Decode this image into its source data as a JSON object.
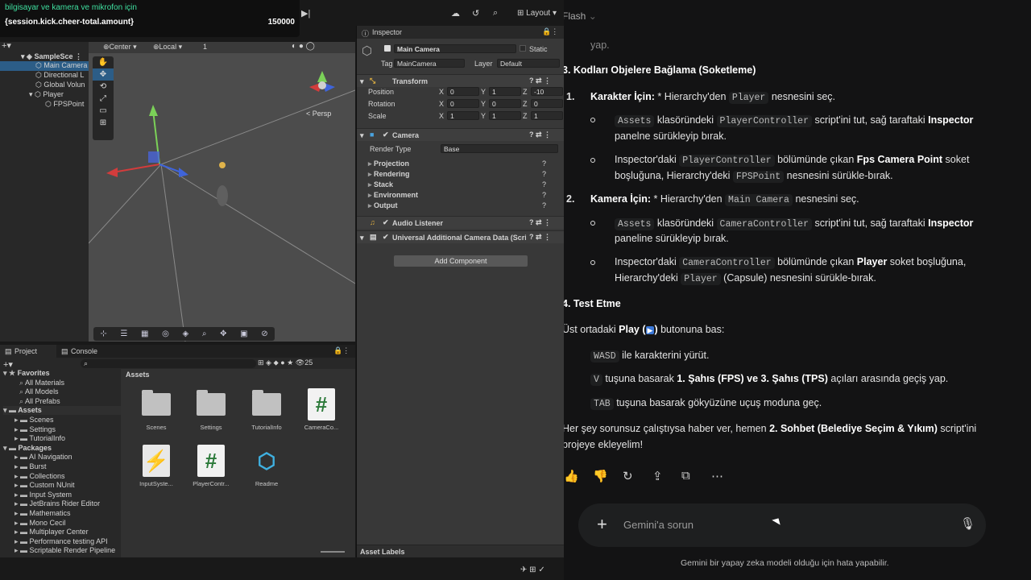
{
  "overlay": {
    "line1": "bilgisayar ve kamera ve mikrofon için",
    "line2_key": "{session.kick.cheer-total.amount}",
    "line2_value": "150000"
  },
  "unity": {
    "layout_label": "Layout",
    "hierarchy": {
      "items": [
        "SampleSce",
        "Main Camera",
        "Directional L",
        "Global Volun",
        "Player",
        "FPSPoint"
      ]
    },
    "scene": {
      "pivot": "Center",
      "space": "Local",
      "grid_value": "1",
      "persp_label": "< Persp"
    },
    "inspector": {
      "tab": "Inspector",
      "object_name": "Main Camera",
      "static_label": "Static",
      "tag_label": "Tag",
      "tag_value": "MainCamera",
      "layer_label": "Layer",
      "layer_value": "Default",
      "transform": {
        "title": "Transform",
        "position_label": "Position",
        "rotation_label": "Rotation",
        "scale_label": "Scale",
        "position": [
          "0",
          "1",
          "-10"
        ],
        "rotation": [
          "0",
          "0",
          "0"
        ],
        "scale": [
          "1",
          "1",
          "1"
        ]
      },
      "camera": {
        "title": "Camera",
        "render_type_label": "Render Type",
        "render_type_value": "Base",
        "sections": [
          "Projection",
          "Rendering",
          "Stack",
          "Environment",
          "Output"
        ]
      },
      "audio_listener": "Audio Listener",
      "urp_data": "Universal Additional Camera Data (Scri",
      "add_component": "Add Component",
      "asset_labels": "Asset Labels"
    },
    "project": {
      "tab_project": "Project",
      "tab_console": "Console",
      "count": "25",
      "assets_header": "Assets",
      "tree": [
        {
          "label": "Favorites",
          "level": 0,
          "bold": true
        },
        {
          "label": "All Materials",
          "level": 2
        },
        {
          "label": "All Models",
          "level": 2
        },
        {
          "label": "All Prefabs",
          "level": 2
        },
        {
          "label": "Assets",
          "level": 0,
          "bold": true
        },
        {
          "label": "Scenes",
          "level": 1
        },
        {
          "label": "Settings",
          "level": 1
        },
        {
          "label": "TutorialInfo",
          "level": 1
        },
        {
          "label": "Packages",
          "level": 0,
          "bold": true
        },
        {
          "label": "AI Navigation",
          "level": 1
        },
        {
          "label": "Burst",
          "level": 1
        },
        {
          "label": "Collections",
          "level": 1
        },
        {
          "label": "Custom NUnit",
          "level": 1
        },
        {
          "label": "Input System",
          "level": 1
        },
        {
          "label": "JetBrains Rider Editor",
          "level": 1
        },
        {
          "label": "Mathematics",
          "level": 1
        },
        {
          "label": "Mono Cecil",
          "level": 1
        },
        {
          "label": "Multiplayer Center",
          "level": 1
        },
        {
          "label": "Performance testing API",
          "level": 1
        },
        {
          "label": "Scriptable Render Pipeline",
          "level": 1
        }
      ],
      "assets": [
        {
          "name": "Scenes",
          "kind": "folder"
        },
        {
          "name": "Settings",
          "kind": "folder"
        },
        {
          "name": "TutorialInfo",
          "kind": "folder"
        },
        {
          "name": "CameraCo...",
          "kind": "script"
        },
        {
          "name": "InputSyste...",
          "kind": "inputsystem"
        },
        {
          "name": "PlayerContr...",
          "kind": "script"
        },
        {
          "name": "Readme",
          "kind": "readme"
        }
      ]
    }
  },
  "gemini": {
    "model_label": "Flash",
    "top_fragment": "yap.",
    "heading3": "3. Kodları Objelere Bağlama (Soketleme)",
    "step1": {
      "num": "1.",
      "title": "Karakter İçin:",
      "pre": " * Hierarchy'den ",
      "code": "Player",
      "post": " nesnesini seç."
    },
    "b1a": {
      "code1": "Assets",
      "t1": " klasöründeki ",
      "code2": "PlayerController",
      "t2": " script'ini tut, sağ taraftaki ",
      "bold": "Inspector",
      "t3": "panelne sürükleyip bırak."
    },
    "b1b": {
      "t0": "Inspector'daki ",
      "code1": "PlayerController",
      "t1": " bölümünde çıkan ",
      "bold": "Fps Camera Point",
      "t2": " soket",
      "t3": "boşluğuna, Hierarchy'deki ",
      "code2": "FPSPoint",
      "t4": " nesnesini sürükle-bırak."
    },
    "step2": {
      "num": "2.",
      "title": "Kamera İçin:",
      "pre": " * Hierarchy'den ",
      "code": "Main Camera",
      "post": " nesnesini seç."
    },
    "b2a": {
      "code1": "Assets",
      "t1": " klasöründeki ",
      "code2": "CameraController",
      "t2": " script'ini tut, sağ taraftaki ",
      "bold": "Inspector",
      "t3": "paneline sürükleyip bırak."
    },
    "b2b": {
      "t0": "Inspector'daki ",
      "code1": "CameraController",
      "t1": " bölümünde çıkan ",
      "bold": "Player",
      "t2": " soket boşluğuna,",
      "t3": "Hierarchy'deki ",
      "code2": "Player",
      "t4": " (Capsule) nesnesini sürükle-bırak."
    },
    "heading4": "4. Test Etme",
    "play_line": {
      "pre": "Üst ortadaki ",
      "bold": "Play (",
      "icon": "▶",
      "bold2": ")",
      "post": " butonuna bas:"
    },
    "b3": {
      "code": "WASD",
      "t": " ile karakterini yürüt."
    },
    "b4": {
      "code": "V",
      "t1": " tuşuna basarak ",
      "bold": "1. Şahıs (FPS) ve 3. Şahıs (TPS)",
      "t2": " açıları arasında geçiş yap."
    },
    "b5": {
      "code": "TAB",
      "t": " tuşuna basarak gökyüzüne uçuş moduna geç."
    },
    "closing": {
      "pre": "Her şey sorunsuz çalıştıysa haber ver, hemen ",
      "bold": "2. Sohbet (Belediye Seçim & Yıkım)",
      "post": " script'ini",
      "line2": "projeye ekleyelim!"
    },
    "prompt_placeholder": "Gemini'a sorun",
    "disclaimer": "Gemini bir yapay zeka modeli olduğu için hata yapabilir."
  }
}
